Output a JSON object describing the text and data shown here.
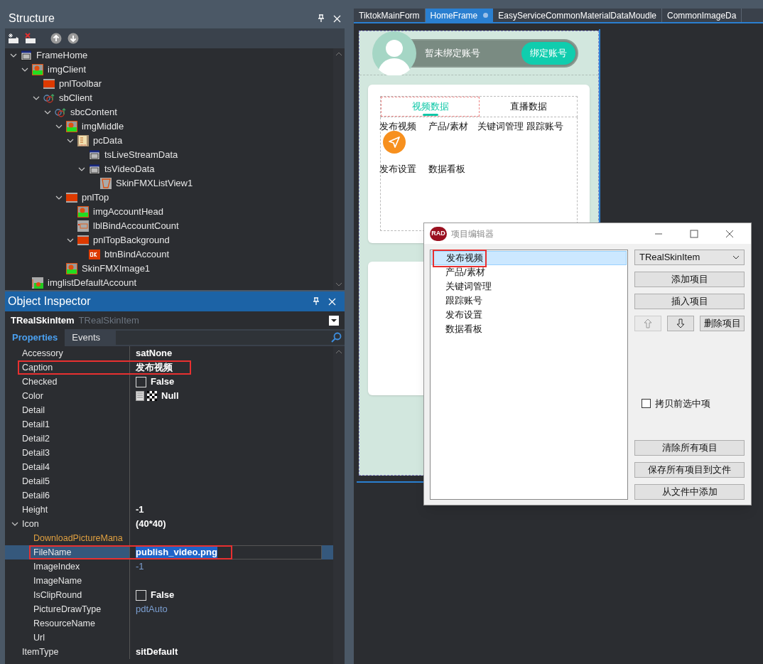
{
  "structure": {
    "title": "Structure",
    "tree": [
      {
        "label": "FrameHome",
        "kind": "form",
        "expanded": true,
        "children": [
          {
            "label": "imgClient",
            "kind": "image",
            "expanded": true,
            "children": [
              {
                "label": "pnlToolbar",
                "kind": "panel"
              },
              {
                "label": "sbClient",
                "kind": "scrollbox",
                "expanded": true,
                "children": [
                  {
                    "label": "sbcContent",
                    "kind": "scrollbox",
                    "expanded": true,
                    "children": [
                      {
                        "label": "imgMiddle",
                        "kind": "image",
                        "expanded": true,
                        "children": [
                          {
                            "label": "pcData",
                            "kind": "pagecontrol",
                            "expanded": true,
                            "children": [
                              {
                                "label": "tsLiveStreamData",
                                "kind": "form"
                              },
                              {
                                "label": "tsVideoData",
                                "kind": "form",
                                "expanded": true,
                                "children": [
                                  {
                                    "label": "SkinFMXListView1",
                                    "kind": "listview"
                                  }
                                ]
                              }
                            ]
                          }
                        ]
                      },
                      {
                        "label": "pnlTop",
                        "kind": "panel",
                        "expanded": true,
                        "children": [
                          {
                            "label": "imgAccountHead",
                            "kind": "image"
                          },
                          {
                            "label": "lblBindAccountCount",
                            "kind": "label"
                          },
                          {
                            "label": "pnlTopBackground",
                            "kind": "panel",
                            "expanded": true,
                            "children": [
                              {
                                "label": "btnBindAccount",
                                "kind": "button"
                              }
                            ]
                          }
                        ]
                      },
                      {
                        "label": "SkinFMXImage1",
                        "kind": "image"
                      }
                    ]
                  }
                ]
              }
            ]
          },
          {
            "label": "imglistDefaultAccount",
            "kind": "imagelist"
          }
        ]
      }
    ]
  },
  "inspector": {
    "title": "Object Inspector",
    "object_name": "TRealSkinItem",
    "object_type": "TRealSkinItem",
    "tabs": [
      {
        "label": "Properties",
        "selected": true
      },
      {
        "label": "Events",
        "selected": false
      }
    ],
    "properties": [
      {
        "name": "Accessory",
        "value": "satNone",
        "kind": "text",
        "marked": false,
        "selected": false
      },
      {
        "name": "Caption",
        "value": "发布视频",
        "kind": "text",
        "marked": true,
        "selected": false
      },
      {
        "name": "Checked",
        "value": "False",
        "kind": "checkbox",
        "checked": false,
        "marked": false,
        "selected": false
      },
      {
        "name": "Color",
        "value": "Null",
        "kind": "color",
        "marked": false,
        "selected": false
      },
      {
        "name": "Detail",
        "kind": "empty",
        "marked": false,
        "selected": false
      },
      {
        "name": "Detail1",
        "kind": "empty",
        "marked": false,
        "selected": false
      },
      {
        "name": "Detail2",
        "kind": "empty",
        "marked": false,
        "selected": false
      },
      {
        "name": "Detail3",
        "kind": "empty",
        "marked": false,
        "selected": false
      },
      {
        "name": "Detail4",
        "kind": "empty",
        "marked": false,
        "selected": false
      },
      {
        "name": "Detail5",
        "kind": "empty",
        "marked": false,
        "selected": false
      },
      {
        "name": "Detail6",
        "kind": "empty",
        "marked": false,
        "selected": false
      },
      {
        "name": "Height",
        "value": "-1",
        "kind": "text",
        "marked": false,
        "selected": false
      },
      {
        "name": "Icon",
        "value": "(40*40)",
        "kind": "text",
        "marked": false,
        "selected": false,
        "expanded": true,
        "children": [
          {
            "name": "DownloadPictureMana",
            "kind": "reference",
            "marked": false,
            "selected": false
          },
          {
            "name": "FileName",
            "value": "publish_video.png",
            "kind": "editing",
            "marked": true,
            "selected": true
          },
          {
            "name": "ImageIndex",
            "value": "-1",
            "kind": "default",
            "marked": false,
            "selected": false
          },
          {
            "name": "ImageName",
            "kind": "empty",
            "marked": false,
            "selected": false
          },
          {
            "name": "IsClipRound",
            "value": "False",
            "kind": "checkbox",
            "checked": false,
            "marked": false,
            "selected": false
          },
          {
            "name": "PictureDrawType",
            "value": "pdtAuto",
            "kind": "default",
            "marked": false,
            "selected": false
          },
          {
            "name": "ResourceName",
            "kind": "empty",
            "marked": false,
            "selected": false
          },
          {
            "name": "Url",
            "kind": "empty",
            "marked": false,
            "selected": false
          }
        ]
      },
      {
        "name": "ItemType",
        "value": "sitDefault",
        "kind": "text",
        "marked": false,
        "selected": false
      }
    ]
  },
  "designer": {
    "tabs": [
      {
        "label": "TiktokMainForm",
        "selected": false,
        "modified": false
      },
      {
        "label": "HomeFrame",
        "selected": true,
        "modified": true
      },
      {
        "label": "EasyServiceCommonMaterialDataMoudle",
        "selected": false,
        "modified": false
      },
      {
        "label": "CommonImageDa",
        "selected": false,
        "modified": false
      }
    ],
    "account_text": "暂未绑定账号",
    "bind_button": "绑定账号",
    "data_tabs": [
      {
        "label": "视频数据",
        "selected": true
      },
      {
        "label": "直播数据",
        "selected": false
      }
    ],
    "grid_items": [
      "发布视频",
      "产品/素材",
      "关键词管理",
      "跟踪账号",
      "发布设置",
      "数据看板"
    ]
  },
  "dialog": {
    "title": "项目编辑器",
    "logo": "RAD",
    "items": [
      {
        "label": "发布视频",
        "selected": true,
        "marked": true
      },
      {
        "label": "产品/素材",
        "selected": false,
        "marked": false
      },
      {
        "label": "关键词管理",
        "selected": false,
        "marked": false
      },
      {
        "label": "跟踪账号",
        "selected": false,
        "marked": false
      },
      {
        "label": "发布设置",
        "selected": false,
        "marked": false
      },
      {
        "label": "数据看板",
        "selected": false,
        "marked": false
      }
    ],
    "type_select": "TRealSkinItem",
    "add_button": "添加项目",
    "insert_button": "插入项目",
    "up_disabled": true,
    "down_disabled": false,
    "delete_button": "删除项目",
    "copy_checkbox": {
      "label": "拷贝前选中项",
      "checked": false
    },
    "bottom_buttons": [
      "清除所有项目",
      "保存所有项目到文件",
      "从文件中添加"
    ]
  }
}
